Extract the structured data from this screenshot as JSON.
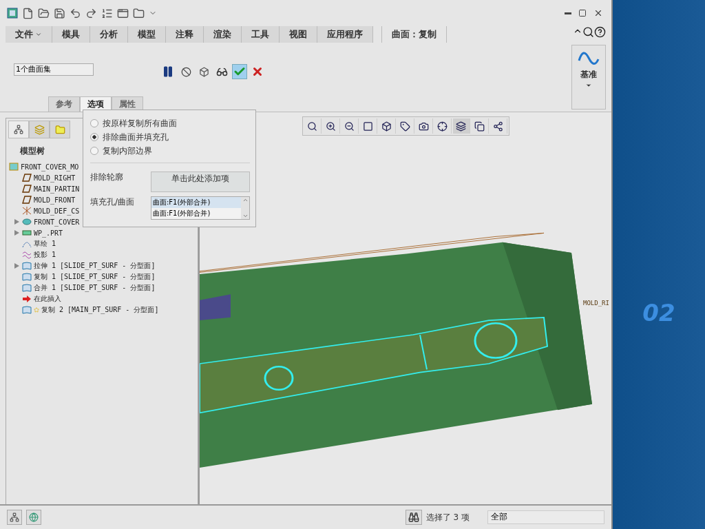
{
  "ribbon_tabs": [
    {
      "label": "文件",
      "kind": "menu",
      "selected": false
    },
    {
      "label": "模具",
      "kind": "tab",
      "selected": false
    },
    {
      "label": "分析",
      "kind": "tab",
      "selected": false
    },
    {
      "label": "模型",
      "kind": "tab",
      "selected": false
    },
    {
      "label": "注释",
      "kind": "tab",
      "selected": false
    },
    {
      "label": "渲染",
      "kind": "tab",
      "selected": false
    },
    {
      "label": "工具",
      "kind": "tab",
      "selected": false
    },
    {
      "label": "视图",
      "kind": "tab",
      "selected": false
    },
    {
      "label": "应用程序",
      "kind": "tab",
      "selected": false
    },
    {
      "label": "曲面：复制",
      "kind": "tab",
      "selected": true
    }
  ],
  "dashboard": {
    "collector": "1个曲面集",
    "datum_button": "基准",
    "panel_tabs": [
      {
        "label": "参考",
        "selected": false
      },
      {
        "label": "选项",
        "selected": true
      },
      {
        "label": "属性",
        "selected": false
      }
    ]
  },
  "options_panel": {
    "radios": [
      {
        "label": "按原样复制所有曲面",
        "selected": false
      },
      {
        "label": "排除曲面并填充孔",
        "selected": true
      },
      {
        "label": "复制内部边界",
        "selected": false
      }
    ],
    "exclude_label": "排除轮廓",
    "exclude_button": "单击此处添加项",
    "fill_label": "填充孔/曲面",
    "fill_items": [
      {
        "label": "曲面:F1(外部合并)",
        "selected": true
      },
      {
        "label": "曲面:F1(外部合并)",
        "selected": false
      }
    ]
  },
  "model_tree": {
    "tabs": [
      {
        "kind": "tree",
        "selected": true
      },
      {
        "kind": "layers",
        "selected": false
      },
      {
        "kind": "favorites",
        "selected": false
      }
    ],
    "title": "模型树",
    "items": [
      {
        "label": "FRONT_COVER_MO",
        "kind": "part",
        "children": [
          {
            "label": "MOLD_RIGHT",
            "kind": "plane"
          },
          {
            "label": "MAIN_PARTIN",
            "kind": "plane"
          },
          {
            "label": "MOLD_FRONT",
            "kind": "plane"
          },
          {
            "label": "MOLD_DEF_CS",
            "kind": "csys"
          },
          {
            "label": "FRONT_COVER",
            "kind": "component",
            "expanded": false
          },
          {
            "label": "WP_.PRT",
            "kind": "workpiece",
            "expanded": false
          },
          {
            "label": "草绘 1",
            "kind": "sketch"
          },
          {
            "label": "投影 1",
            "kind": "projection"
          },
          {
            "label": "拉伸 1 [SLIDE_PT_SURF - 分型面]",
            "kind": "surface",
            "expanded": false
          },
          {
            "label": "复制 1 [SLIDE_PT_SURF - 分型面]",
            "kind": "surface"
          },
          {
            "label": "合并 1 [SLIDE_PT_SURF - 分型面]",
            "kind": "surface"
          },
          {
            "label": "在此插入",
            "kind": "insert"
          },
          {
            "label": "复制 2 [MAIN_PT_SURF - 分型面]",
            "kind": "surface",
            "new": true
          }
        ]
      }
    ]
  },
  "viewport": {
    "plane_label": "MOLD_RI"
  },
  "status_bar": {
    "selection": "选择了 3 项",
    "filter": "全部"
  },
  "desktop": {
    "wallpaper_text": "02"
  }
}
